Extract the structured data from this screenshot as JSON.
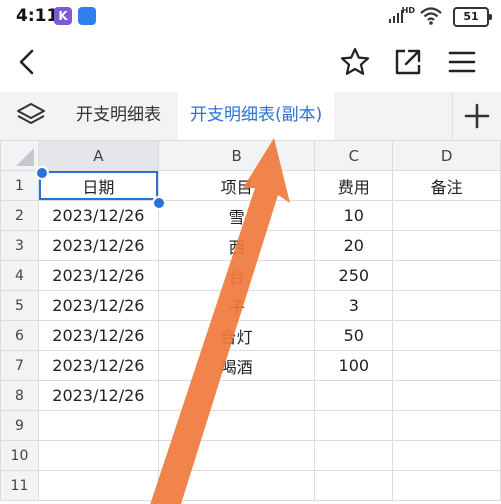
{
  "status_bar": {
    "time": "4:11",
    "app_icon_k": "K",
    "network": "HD",
    "battery": "51",
    "icons": [
      "k-app-icon",
      "blue-app-icon",
      "signal-icon",
      "wifi-icon",
      "battery-icon"
    ]
  },
  "toolbar": {
    "icons": [
      "back-icon",
      "star-icon",
      "share-icon",
      "menu-icon"
    ]
  },
  "tabs": {
    "items": [
      {
        "label": "开支明细表",
        "active": false
      },
      {
        "label": "开支明细表(副本)",
        "active": true
      }
    ],
    "accent": "#2a72d6"
  },
  "sheet": {
    "columns": [
      "A",
      "B",
      "C",
      "D"
    ],
    "rows": [
      {
        "n": "1",
        "cells": [
          "日期",
          "项目",
          "费用",
          "备注"
        ]
      },
      {
        "n": "2",
        "cells": [
          "2023/12/26",
          "雪",
          "10",
          ""
        ]
      },
      {
        "n": "3",
        "cells": [
          "2023/12/26",
          "西",
          "20",
          ""
        ]
      },
      {
        "n": "4",
        "cells": [
          "2023/12/26",
          "台",
          "250",
          ""
        ]
      },
      {
        "n": "5",
        "cells": [
          "2023/12/26",
          "子",
          "3",
          ""
        ]
      },
      {
        "n": "6",
        "cells": [
          "2023/12/26",
          "台灯",
          "50",
          ""
        ]
      },
      {
        "n": "7",
        "cells": [
          "2023/12/26",
          "喝酒",
          "100",
          ""
        ]
      },
      {
        "n": "8",
        "cells": [
          "2023/12/26",
          "",
          "",
          ""
        ]
      },
      {
        "n": "9",
        "cells": [
          "",
          "",
          "",
          ""
        ]
      },
      {
        "n": "10",
        "cells": [
          "",
          "",
          "",
          ""
        ]
      },
      {
        "n": "11",
        "cells": [
          "",
          "",
          "",
          ""
        ]
      }
    ]
  },
  "annotation": {
    "color": "#f07a3c",
    "icon": "arrow-annotation"
  }
}
